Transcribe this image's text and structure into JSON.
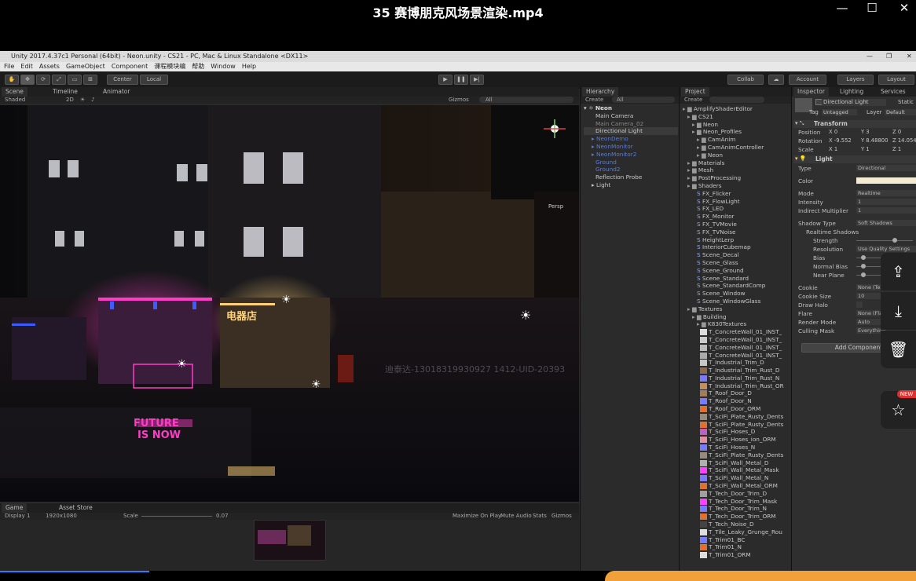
{
  "player": {
    "title": "35 赛博朋克风场景渲染.mp4",
    "minimize_icon": "minimize-icon",
    "maximize_icon": "maximize-icon",
    "close_icon": "close-icon"
  },
  "unity": {
    "window_title": "Unity 2017.4.37c1 Personal (64bit) - Neon.unity - CS21 - PC, Mac & Linux Standalone <DX11>",
    "menu": [
      "File",
      "Edit",
      "Assets",
      "GameObject",
      "Component",
      "课程模块编",
      "帮助",
      "Window",
      "Help"
    ],
    "toolbar": {
      "pivot_label": "Center",
      "space_label": "Local",
      "collab_label": "Collab",
      "account_label": "Account",
      "layers_label": "Layers",
      "layout_label": "Layout"
    },
    "scene_tabs": [
      "Scene",
      "Timeline",
      "Animator"
    ],
    "scene_toolbar": {
      "shading": "Shaded",
      "mode_2d": "2D",
      "gizmos": "Gizmos",
      "search_placeholder": "All"
    },
    "gizmo_label": "Persp",
    "watermark": "迪泰达-13018319930927 1412-UID-20393",
    "sign_text_1": "FUTURE",
    "sign_text_2": "IS NOW",
    "sign_text_3": "电器店",
    "game_tabs": [
      "Game",
      "Asset Store"
    ],
    "game_toolbar": {
      "display": "Display 1",
      "resolution": "1920x1080",
      "scale_label": "Scale",
      "scale_value": "0.07",
      "maximize_on_play": "Maximize On Play",
      "mute_audio": "Mute Audio",
      "stats": "Stats",
      "gizmos": "Gizmos"
    },
    "hierarchy": {
      "tab": "Hierarchy",
      "create": "Create",
      "search_placeholder": "All",
      "scene_name": "Neon",
      "items": [
        "Main Camera",
        "Main Camera_02",
        "Directional Light",
        "NeonDemo",
        "NeonMonitor",
        "NeonMonitor2",
        "Ground",
        "Ground2",
        "Reflection Probe",
        "Light"
      ]
    },
    "project": {
      "tab": "Project",
      "create": "Create",
      "folders": [
        "AmplifyShaderEditor",
        "CS21",
        "Neon",
        "Neon_Profiles",
        "CamAnim",
        "CamAnimController",
        "Neon",
        "Materials",
        "Mesh",
        "PostProcessing",
        "Shaders",
        "FX_Flicker",
        "FX_FlowLight",
        "FX_LED",
        "FX_Monitor",
        "FX_TVMovie",
        "FX_TVNoise",
        "HeightLerp",
        "InteriorCubemap",
        "Scene_Decal",
        "Scene_Glass",
        "Scene_Ground",
        "Scene_Standard",
        "Scene_StandardComp",
        "Scene_Window",
        "Scene_WindowGlass",
        "Textures",
        "Building",
        "K830Textures",
        "T_ConcreteWall_01_INST_",
        "T_ConcreteWall_01_INST_",
        "T_ConcreteWall_01_INST_",
        "T_ConcreteWall_01_INST_",
        "T_Industrial_Trim_D",
        "T_Industrial_Trim_Rust_D",
        "T_Industrial_Trim_Rust_N",
        "T_Industrial_Trim_Rust_OR",
        "T_Roof_Door_D",
        "T_Roof_Door_N",
        "T_Roof_Door_ORM",
        "T_SciFi_Plate_Rusty_Dents",
        "T_SciFi_Plate_Rusty_Dents",
        "T_SciFi_Hoses_D",
        "T_SciFi_Hoses_ion_ORM",
        "T_SciFi_Hoses_N",
        "T_SciFi_Plate_Rusty_Dents",
        "T_SciFi_Wall_Metal_D",
        "T_SciFi_Wall_Metal_Mask",
        "T_SciFi_Wall_Metal_N",
        "T_SciFi_Wall_Metal_ORM",
        "T_Tech_Door_Trim_D",
        "T_Tech_Door_Trim_Mask",
        "T_Tech_Door_Trim_N",
        "T_Tech_Door_Trim_ORM",
        "T_Tech_Noise_D",
        "T_Tile_Leaky_Grunge_Rou",
        "T_Trim01_BC",
        "T_Trim01_N",
        "T_Trim01_ORM"
      ]
    },
    "inspector": {
      "tab_inspector": "Inspector",
      "tab_lighting": "Lighting",
      "tab_services": "Services",
      "object_name": "Directional Light",
      "static_label": "Static",
      "tag_label": "Tag",
      "tag_value": "Untagged",
      "layer_label": "Layer",
      "layer_value": "Default",
      "transform_label": "Transform",
      "position_label": "Position",
      "position": [
        "X 0",
        "Y 3",
        "Z 0"
      ],
      "rotation_label": "Rotation",
      "rotation": [
        "X -9.552",
        "Y 8.48800",
        "Z 14.054"
      ],
      "scale_label": "Scale",
      "scale": [
        "X 1",
        "Y 1",
        "Z 1"
      ],
      "light_label": "Light",
      "rows": [
        {
          "label": "Type",
          "value": "Directional"
        },
        {
          "label": "Color",
          "value": ""
        },
        {
          "label": "Mode",
          "value": "Realtime"
        },
        {
          "label": "Intensity",
          "value": "1"
        },
        {
          "label": "Indirect Multiplier",
          "value": "1"
        },
        {
          "label": "Shadow Type",
          "value": "Soft Shadows"
        },
        {
          "label": "Realtime Shadows",
          "value": ""
        },
        {
          "label": "Strength",
          "value": ""
        },
        {
          "label": "Resolution",
          "value": "Use Quality Settings"
        },
        {
          "label": "Bias",
          "value": ""
        },
        {
          "label": "Normal Bias",
          "value": ""
        },
        {
          "label": "Near Plane",
          "value": ""
        },
        {
          "label": "Cookie",
          "value": "None (Texture)"
        },
        {
          "label": "Cookie Size",
          "value": "10"
        },
        {
          "label": "Draw Halo",
          "value": ""
        },
        {
          "label": "Flare",
          "value": "None (Flare)"
        },
        {
          "label": "Render Mode",
          "value": "Auto"
        },
        {
          "label": "Culling Mask",
          "value": "Everything"
        }
      ],
      "add_component": "Add Component"
    }
  },
  "side_actions": {
    "share_icon": "share-icon",
    "download_icon": "download-icon",
    "delete_icon": "trash-icon",
    "pin_icon": "pin-icon",
    "new_badge": "NEW"
  },
  "colors": {
    "neon_pink": "#ff3cc8",
    "neon_blue": "#3c5cff",
    "warm_light": "#ffd27a",
    "light_color_swatch": "#f3ecd2"
  }
}
